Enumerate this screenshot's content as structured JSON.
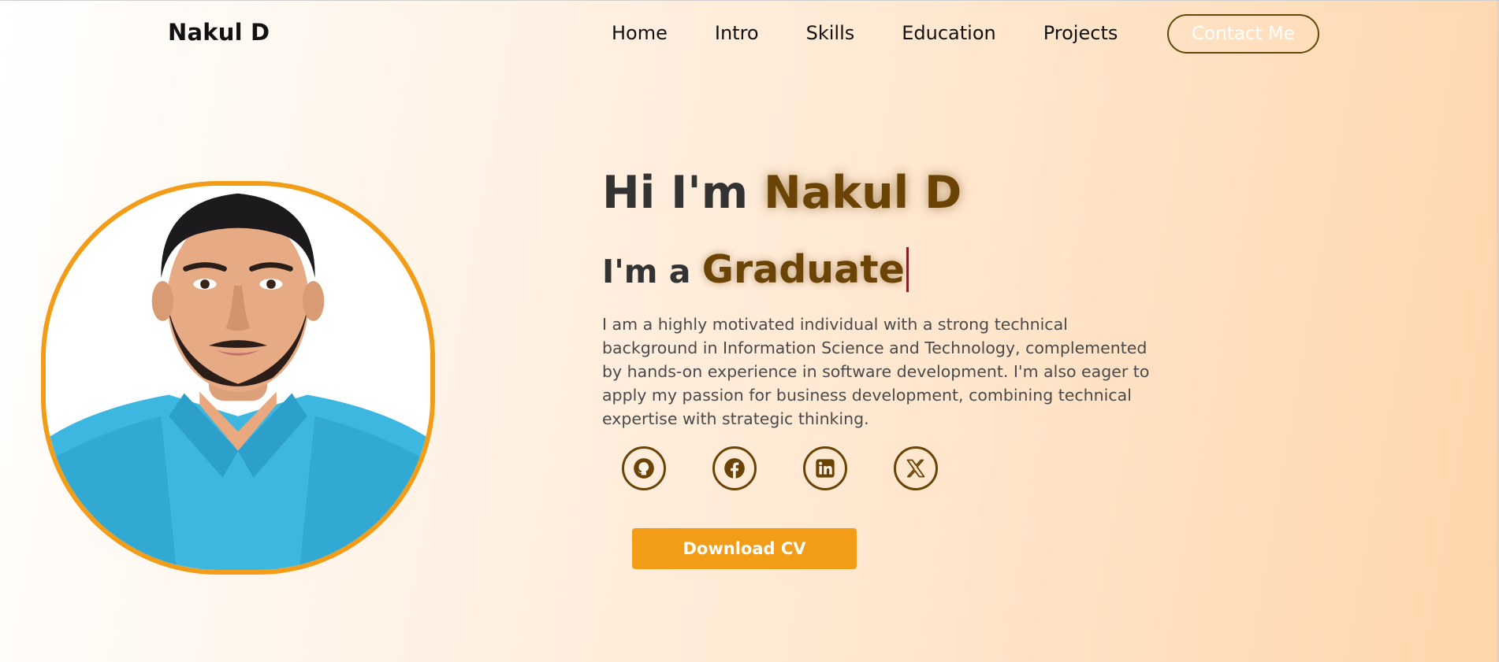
{
  "header": {
    "brand": "Nakul D",
    "nav": [
      "Home",
      "Intro",
      "Skills",
      "Education",
      "Projects"
    ],
    "contact_label": "Contact Me"
  },
  "hero": {
    "greeting": "Hi I'm",
    "name": "Nakul D",
    "role_prefix": "I'm a",
    "role": "Graduate",
    "description": "I am a highly motivated individual with a strong technical background in Information Science and Technology, complemented by hands-on experience in software development. I'm also eager to apply my passion for business development, combining technical expertise with strategic thinking.",
    "download_label": "Download CV"
  },
  "socials": [
    "github-icon",
    "facebook-icon",
    "linkedin-icon",
    "x-twitter-icon"
  ],
  "colors": {
    "accent": "#f29c18",
    "brown": "#6b4405",
    "background_start": "#ffffff",
    "background_end": "#ffd5ab"
  }
}
